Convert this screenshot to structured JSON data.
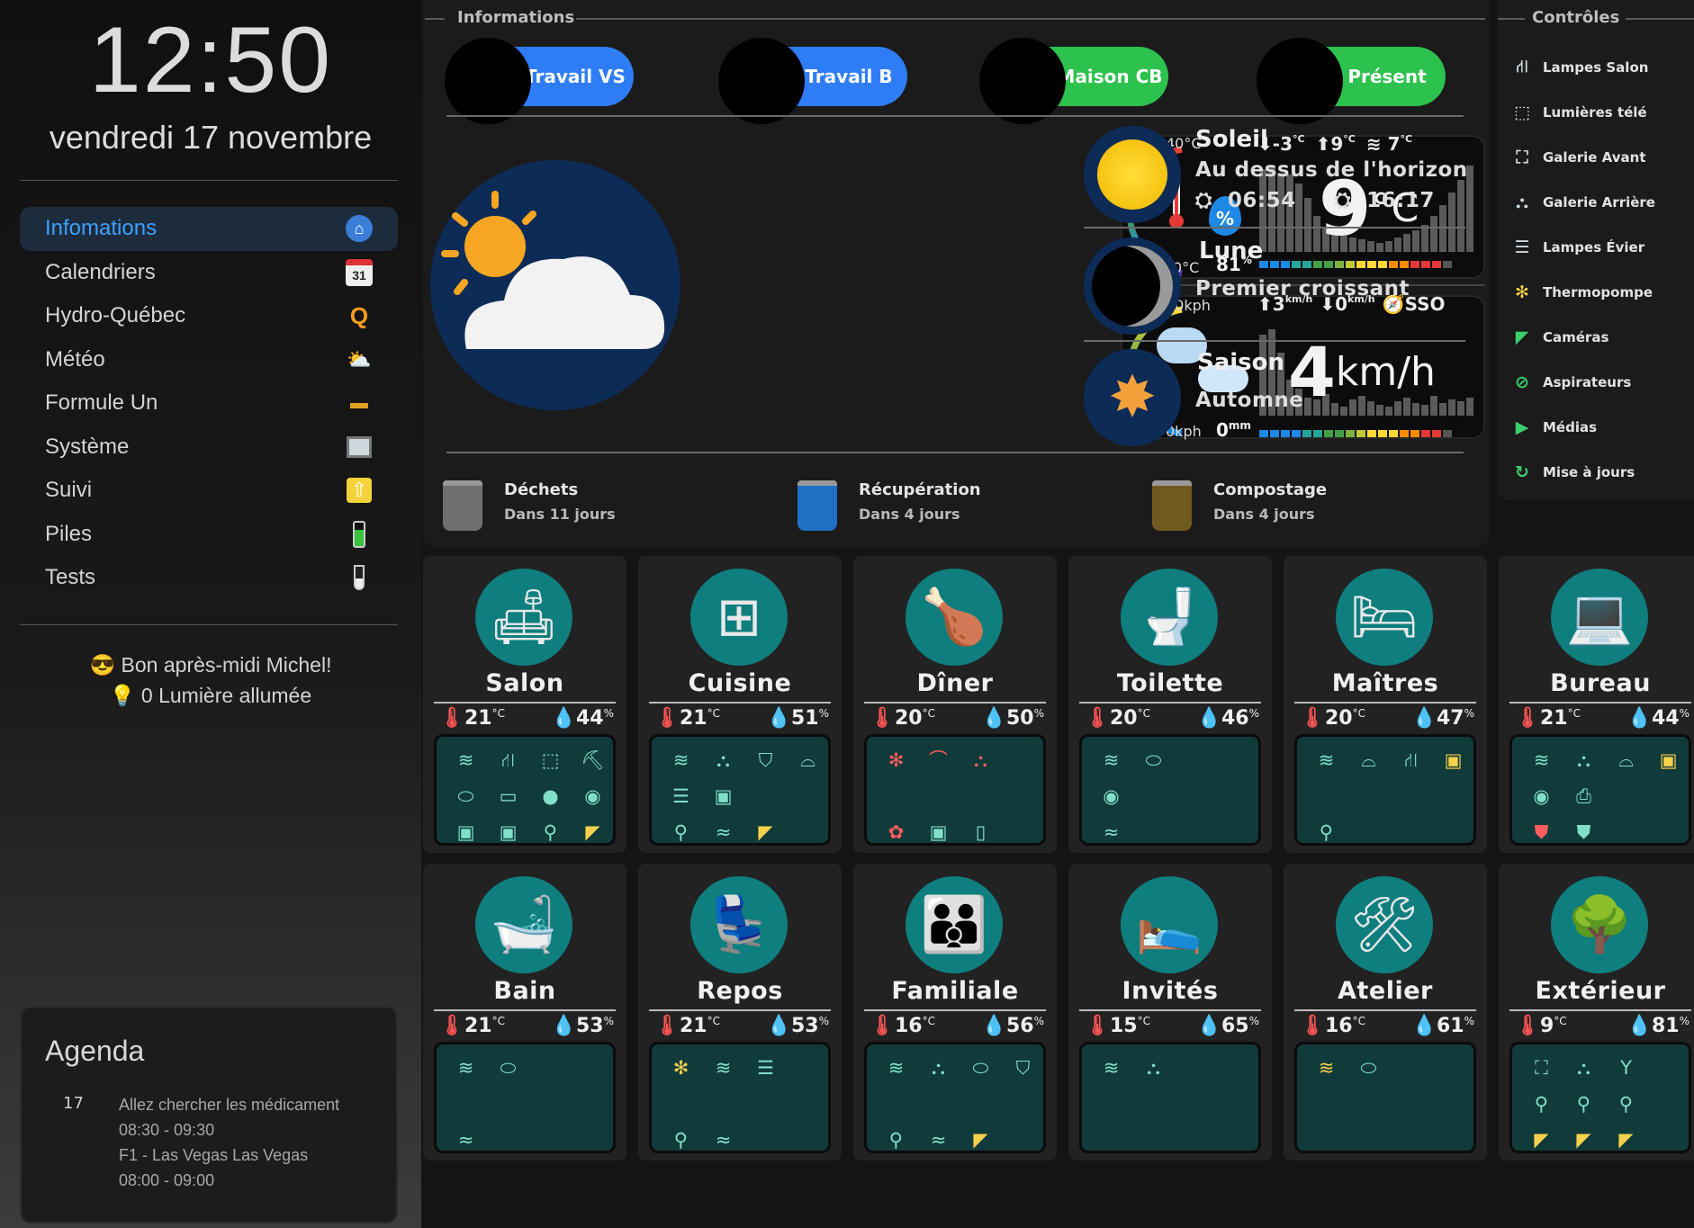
{
  "sidebar": {
    "clock": "12:50",
    "date": "vendredi 17 novembre",
    "nav": [
      {
        "label": "Infomations",
        "icon": "home-icon"
      },
      {
        "label": "Calendriers",
        "icon": "calendar-icon",
        "badge": "31"
      },
      {
        "label": "Hydro-Québec",
        "icon": "hydro-icon"
      },
      {
        "label": "Météo",
        "icon": "weather-icon"
      },
      {
        "label": "Formule Un",
        "icon": "f1-car-icon"
      },
      {
        "label": "Système",
        "icon": "computer-icon"
      },
      {
        "label": "Suivi",
        "icon": "arrow-up-icon"
      },
      {
        "label": "Piles",
        "icon": "battery-icon"
      },
      {
        "label": "Tests",
        "icon": "test-tube-icon"
      }
    ],
    "greeting": "😎 Bon après-midi Michel!",
    "lights": "💡 0 Lumière allumée",
    "agenda": {
      "title": "Agenda",
      "day": "17",
      "events": [
        {
          "title": "Allez chercher les médicament",
          "time": "08:30 - 09:30"
        },
        {
          "title": "F1 - Las Vegas Las Vegas",
          "time": "08:00 - 09:00"
        }
      ]
    }
  },
  "info": {
    "title": "Informations",
    "persons": [
      {
        "label": "Travail VS",
        "color": "#2f7df6"
      },
      {
        "label": "Travail B",
        "color": "#2f7df6"
      },
      {
        "label": "Maison CB",
        "color": "#2dc24e"
      },
      {
        "label": "Présent",
        "color": "#2dc24e"
      }
    ],
    "temperature": {
      "max_label": "40°C",
      "min_label": "-40°C",
      "humidity": "81",
      "humidity_unit": "%",
      "low": "-3",
      "high": "9",
      "other": "7",
      "unit": "°C",
      "value": "9",
      "value_unit": "°C"
    },
    "wind": {
      "max_label": "60kph",
      "min_label": "0kph",
      "gust": "3",
      "gust_unit": "km/h",
      "low": "0",
      "direction": "SSO",
      "rain": "0",
      "rain_unit": "mm",
      "value": "4",
      "value_unit": "km/h"
    },
    "sun": {
      "title": "Soleil",
      "state": "Au dessus de l'horizon",
      "rise": "06:54",
      "set": "16:17"
    },
    "moon": {
      "title": "Lune",
      "phase": "Premier croissant"
    },
    "season": {
      "title": "Saison",
      "value": "Automne"
    },
    "waste": [
      {
        "title": "Déchets",
        "when": "Dans 11 jours",
        "color": "#6f6f6f"
      },
      {
        "title": "Récupération",
        "when": "Dans 4 jours",
        "color": "#1f6fc4"
      },
      {
        "title": "Compostage",
        "when": "Dans 4 jours",
        "color": "#6f5a20"
      }
    ]
  },
  "controls": {
    "title": "Contrôles",
    "items": [
      {
        "label": "Lampes Salon",
        "icon": "lamp-icon",
        "glyph": "⛙"
      },
      {
        "label": "Lumières télé",
        "icon": "tv-light-icon",
        "glyph": "⬚"
      },
      {
        "label": "Galerie Avant",
        "icon": "porch-light-icon",
        "glyph": "⛶"
      },
      {
        "label": "Galerie Arrière",
        "icon": "ceiling-light-icon",
        "glyph": "⛬"
      },
      {
        "label": "Lampes Évier",
        "icon": "strip-light-icon",
        "glyph": "☰"
      },
      {
        "label": "Thermopompe",
        "icon": "heat-pump-icon",
        "glyph": "✻"
      },
      {
        "label": "Caméras",
        "icon": "camera-icon",
        "glyph": "◤"
      },
      {
        "label": "Aspirateurs",
        "icon": "vacuum-icon",
        "glyph": "⊘"
      },
      {
        "label": "Médias",
        "icon": "play-icon",
        "glyph": "▶"
      },
      {
        "label": "Mise à jours",
        "icon": "update-icon",
        "glyph": "↻"
      }
    ]
  },
  "rooms": [
    {
      "name": "Salon",
      "temp": "21",
      "hum": "44",
      "pic": "🛋",
      "devices": [
        [
          "heater",
          "≋"
        ],
        [
          "lamp",
          "⛙"
        ],
        [
          "tv-light",
          "⬚"
        ],
        [
          "lamp2",
          "⛏"
        ],
        [
          "ceiling",
          "⬭"
        ],
        [
          "tv",
          "▭"
        ],
        [
          "apple",
          "●"
        ],
        [
          "spotify",
          "◉"
        ],
        [
          "outlet",
          "▣"
        ],
        [
          "outlet2",
          "▣"
        ],
        [
          "motion",
          "⚲"
        ],
        [
          "camera-yellow",
          "◤"
        ]
      ]
    },
    {
      "name": "Cuisine",
      "temp": "21",
      "hum": "51",
      "pic": "⊞",
      "devices": [
        [
          "heater",
          "≋"
        ],
        [
          "track",
          "⛬"
        ],
        [
          "pendant",
          "⛉"
        ],
        [
          "dome",
          "⌓"
        ],
        [
          "strip",
          "☰"
        ],
        [
          "outlet",
          "▣"
        ],
        [
          "",
          ""
        ],
        [
          "",
          ""
        ],
        [
          "motion",
          "⚲"
        ],
        [
          "vibration",
          "≈"
        ],
        [
          "camera-yellow",
          "◤"
        ],
        [
          "",
          ""
        ]
      ]
    },
    {
      "name": "Dîner",
      "temp": "20",
      "hum": "50",
      "pic": "🍗",
      "devices": [
        [
          "heat-pump-red",
          "✻"
        ],
        [
          "strip-red",
          "⌒"
        ],
        [
          "track-red",
          "⛬"
        ],
        [
          "",
          ""
        ],
        [
          "",
          ""
        ],
        [
          "",
          ""
        ],
        [
          "",
          ""
        ],
        [
          "",
          ""
        ],
        [
          "flower-red",
          "✿"
        ],
        [
          "lock",
          "▣"
        ],
        [
          "door",
          "▯"
        ],
        [
          "",
          ""
        ]
      ]
    },
    {
      "name": "Toilette",
      "temp": "20",
      "hum": "46",
      "pic": "🚽",
      "devices": [
        [
          "heater",
          "≋"
        ],
        [
          "ceiling",
          "⬭"
        ],
        [
          "",
          ""
        ],
        [
          "",
          ""
        ],
        [
          "fan",
          "◉"
        ],
        [
          "",
          ""
        ],
        [
          "",
          ""
        ],
        [
          "",
          ""
        ],
        [
          "vibration",
          "≈"
        ],
        [
          "",
          ""
        ],
        [
          "",
          ""
        ],
        [
          "",
          ""
        ]
      ]
    },
    {
      "name": "Maîtres",
      "temp": "20",
      "hum": "47",
      "pic": "🛏",
      "devices": [
        [
          "heater",
          "≋"
        ],
        [
          "ceiling",
          "⌓"
        ],
        [
          "lamp",
          "⛙"
        ],
        [
          "outlet-yellow",
          "▣"
        ],
        [
          "",
          ""
        ],
        [
          "",
          ""
        ],
        [
          "",
          ""
        ],
        [
          "",
          ""
        ],
        [
          "motion",
          "⚲"
        ],
        [
          "",
          ""
        ],
        [
          "",
          ""
        ],
        [
          "",
          ""
        ]
      ]
    },
    {
      "name": "Bureau",
      "temp": "21",
      "hum": "44",
      "pic": "💻",
      "devices": [
        [
          "heater",
          "≋"
        ],
        [
          "track",
          "⛬"
        ],
        [
          "dome",
          "⌓"
        ],
        [
          "outlet-yellow",
          "▣"
        ],
        [
          "fan",
          "◉"
        ],
        [
          "printer",
          "⎙"
        ],
        [
          "",
          ""
        ],
        [
          "",
          ""
        ],
        [
          "shield-red",
          "⛊"
        ],
        [
          "shield",
          "⛊"
        ],
        [
          "",
          ""
        ],
        [
          "",
          ""
        ]
      ]
    },
    {
      "name": "Bain",
      "temp": "21",
      "hum": "53",
      "pic": "🛁",
      "devices": [
        [
          "heater",
          "≋"
        ],
        [
          "ceiling",
          "⬭"
        ],
        [
          "",
          ""
        ],
        [
          "",
          ""
        ],
        [
          "",
          ""
        ],
        [
          "",
          ""
        ],
        [
          "",
          ""
        ],
        [
          "",
          ""
        ],
        [
          "vibration",
          "≈"
        ],
        [
          "",
          ""
        ],
        [
          "",
          ""
        ],
        [
          "",
          ""
        ]
      ]
    },
    {
      "name": "Repos",
      "temp": "21",
      "hum": "53",
      "pic": "💺",
      "devices": [
        [
          "heat-pump-yellow",
          "✻"
        ],
        [
          "heater",
          "≋"
        ],
        [
          "strip",
          "☰"
        ],
        [
          "",
          ""
        ],
        [
          "",
          ""
        ],
        [
          "",
          ""
        ],
        [
          "",
          ""
        ],
        [
          "",
          ""
        ],
        [
          "motion",
          "⚲"
        ],
        [
          "vibration",
          "≈"
        ],
        [
          "",
          ""
        ],
        [
          "",
          ""
        ]
      ]
    },
    {
      "name": "Familiale",
      "temp": "16",
      "hum": "56",
      "pic": "👪",
      "devices": [
        [
          "heater",
          "≋"
        ],
        [
          "fan-lamp",
          "⛬"
        ],
        [
          "ceiling",
          "⬭"
        ],
        [
          "lamp",
          "⛉"
        ],
        [
          "",
          ""
        ],
        [
          "",
          ""
        ],
        [
          "",
          ""
        ],
        [
          "",
          ""
        ],
        [
          "motion",
          "⚲"
        ],
        [
          "vibration",
          "≈"
        ],
        [
          "camera-yellow",
          "◤"
        ],
        [
          "",
          ""
        ]
      ]
    },
    {
      "name": "Invités",
      "temp": "15",
      "hum": "65",
      "pic": "🛌",
      "devices": [
        [
          "heater",
          "≋"
        ],
        [
          "track",
          "⛬"
        ],
        [
          "",
          ""
        ],
        [
          "",
          ""
        ],
        [
          "",
          ""
        ],
        [
          "",
          ""
        ],
        [
          "",
          ""
        ],
        [
          "",
          ""
        ],
        [
          "",
          ""
        ],
        [
          "",
          ""
        ],
        [
          "",
          ""
        ],
        [
          "",
          ""
        ]
      ]
    },
    {
      "name": "Atelier",
      "temp": "16",
      "hum": "61",
      "pic": "🛠",
      "devices": [
        [
          "heater-yellow",
          "≋"
        ],
        [
          "ceiling",
          "⬭"
        ],
        [
          "",
          ""
        ],
        [
          "",
          ""
        ],
        [
          "",
          ""
        ],
        [
          "",
          ""
        ],
        [
          "",
          ""
        ],
        [
          "",
          ""
        ],
        [
          "",
          ""
        ],
        [
          "",
          ""
        ],
        [
          "",
          ""
        ],
        [
          "",
          ""
        ]
      ]
    },
    {
      "name": "Extérieur",
      "temp": "9",
      "hum": "81",
      "pic": "🌳",
      "devices": [
        [
          "porch",
          "⛶"
        ],
        [
          "track",
          "⛬"
        ],
        [
          "glass",
          "Y"
        ],
        [
          "",
          ""
        ],
        [
          "motion",
          "⚲"
        ],
        [
          "motion2",
          "⚲"
        ],
        [
          "motion3",
          "⚲"
        ],
        [
          "",
          ""
        ],
        [
          "camera-yellow",
          "◤"
        ],
        [
          "camera-yellow2",
          "◤"
        ],
        [
          "camera-yellow3",
          "◤"
        ],
        [
          "",
          ""
        ]
      ]
    }
  ]
}
